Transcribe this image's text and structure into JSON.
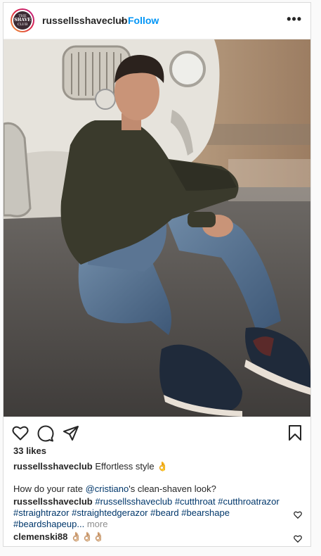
{
  "header": {
    "avatar_text": [
      "THE",
      "SHAVE",
      "CLUB"
    ],
    "username": "russellsshaveclub",
    "separator": "•",
    "follow": "Follow",
    "more": "•••"
  },
  "photo": {
    "description_icon": "photo-image"
  },
  "actions": {
    "like_icon": "heart-icon",
    "comment_icon": "comment-icon",
    "share_icon": "share-icon",
    "save_icon": "bookmark-icon"
  },
  "likes": "33 likes",
  "caption": {
    "username": "russellsshaveclub",
    "text": "Effortless style",
    "emoji": "👌"
  },
  "question": {
    "prefix": "How do your rate ",
    "mention": "@cristiano",
    "suffix": "'s clean-shaven look?"
  },
  "tags": {
    "username": "russellsshaveclub",
    "line1": [
      "#russellsshaveclub",
      "#cutthroat",
      "#cutthroatrazor"
    ],
    "line2": [
      "#straightrazor",
      "#straightedgerazor",
      "#beard",
      "#bearshape"
    ],
    "line3_tag": "#beardshapeup...",
    "more": "more"
  },
  "comment": {
    "username": "clemenski88",
    "text": "👌🏼👌🏼👌🏼"
  }
}
